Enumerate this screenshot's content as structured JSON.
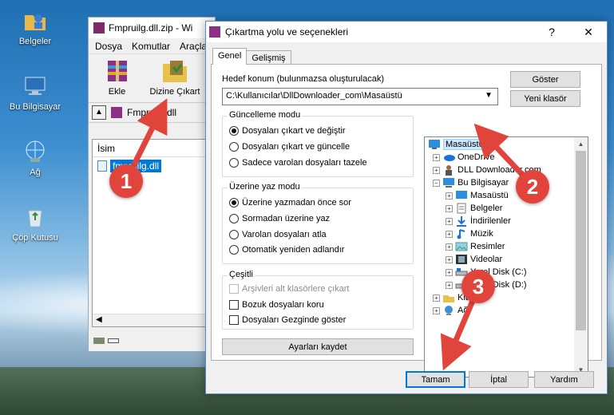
{
  "desktop": {
    "icons": [
      {
        "label": "Belgeler",
        "icon": "documents-folder-icon"
      },
      {
        "label": "Bu Bilgisayar",
        "icon": "computer-icon"
      },
      {
        "label": "Ağ",
        "icon": "network-icon"
      },
      {
        "label": "Çöp Kutusu",
        "icon": "recycle-bin-icon"
      }
    ]
  },
  "winrar": {
    "title": "Fmpruilg.dll.zip - Wi",
    "menu": [
      "Dosya",
      "Komutlar",
      "Araçla"
    ],
    "toolbar": {
      "add": "Ekle",
      "extract": "Dizine Çıkart"
    },
    "path": "Fmpruilg.dll",
    "column_header": "İsim",
    "file": "fmpruilg.dll"
  },
  "dialog": {
    "title": "Çıkartma yolu ve seçenekleri",
    "title_buttons": {
      "help": "?",
      "close": "✕"
    },
    "tabs": [
      "Genel",
      "Gelişmiş"
    ],
    "dest_label": "Hedef konum (bulunmazsa oluşturulacak)",
    "dest_value": "C:\\Kullanıcılar\\DllDownloader_com\\Masaüstü",
    "show_button": "Göster",
    "new_folder_button": "Yeni klasör",
    "update_mode": {
      "title": "Güncelleme modu",
      "options": [
        "Dosyaları çıkart ve değiştir",
        "Dosyaları çıkart ve güncelle",
        "Sadece varolan dosyaları tazele"
      ],
      "selected": 0
    },
    "overwrite_mode": {
      "title": "Üzerine yaz modu",
      "options": [
        "Üzerine yazmadan önce sor",
        "Sormadan üzerine yaz",
        "Varolan dosyaları atla",
        "Otomatik yeniden adlandır"
      ],
      "selected": 0
    },
    "misc": {
      "title": "Çeşitli",
      "options": [
        "Arşivleri alt klasörlere çıkart",
        "Bozuk dosyaları koru",
        "Dosyaları Gezginde göster"
      ]
    },
    "save_settings": "Ayarları kaydet",
    "tree": [
      {
        "label": "Masaüstü",
        "icon": "desktop-icon"
      },
      {
        "label": "OneDrive",
        "icon": "onedrive-icon"
      },
      {
        "label": "DLL Downloader.com",
        "icon": "user-icon"
      },
      {
        "label": "Bu Bilgisayar",
        "icon": "computer-icon"
      },
      {
        "label": "Masaüstü",
        "icon": "desktop-icon"
      },
      {
        "label": "Belgeler",
        "icon": "documents-icon"
      },
      {
        "label": "İndirilenler",
        "icon": "download-icon"
      },
      {
        "label": "Müzik",
        "icon": "music-icon"
      },
      {
        "label": "Resimler",
        "icon": "pictures-icon"
      },
      {
        "label": "Videolar",
        "icon": "videos-icon"
      },
      {
        "label": "Yerel Disk (C:)",
        "icon": "drive-icon"
      },
      {
        "label": "Yerel Disk (D:)",
        "icon": "drive-icon"
      },
      {
        "label": "Kitap",
        "icon": "library-icon"
      },
      {
        "label": "Ağ",
        "icon": "network-icon"
      }
    ],
    "buttons": {
      "ok": "Tamam",
      "cancel": "İptal",
      "help": "Yardım"
    }
  },
  "annotations": [
    "1",
    "2",
    "3"
  ],
  "colors": {
    "annotation": "#e0443b",
    "selection": "#0078d7"
  }
}
